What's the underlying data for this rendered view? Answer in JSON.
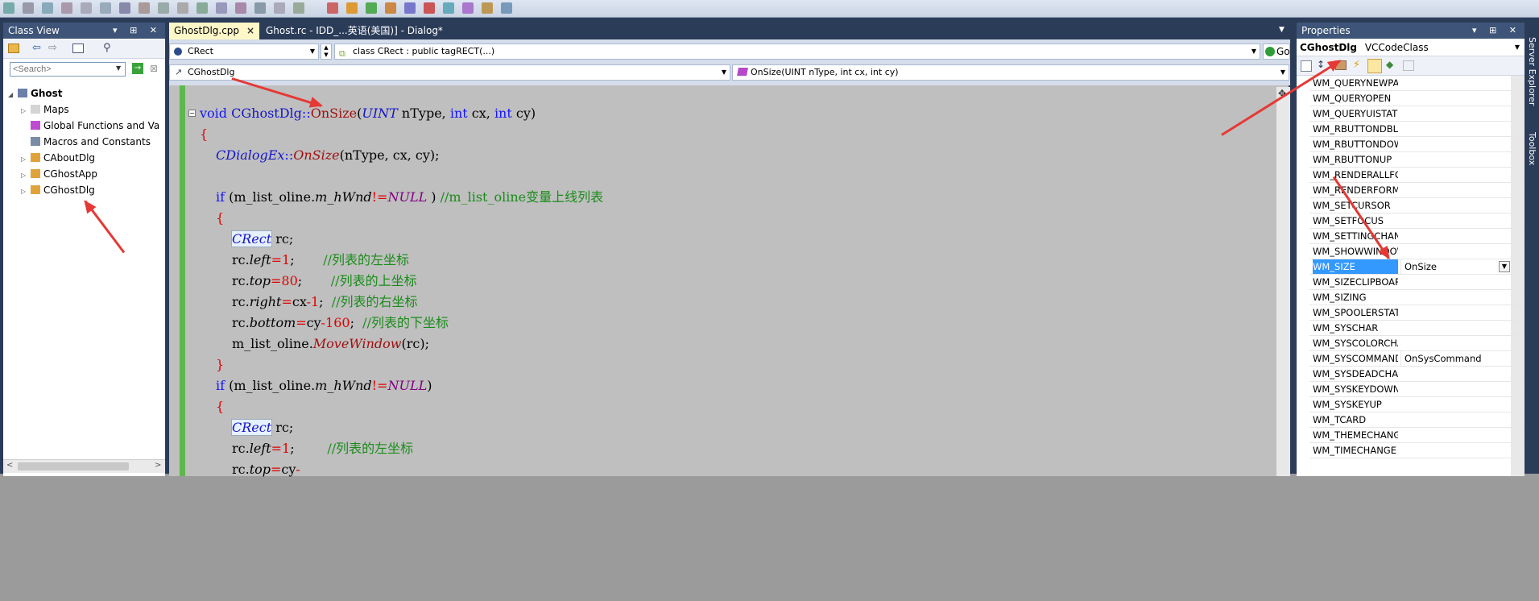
{
  "tabs": [
    {
      "label": "GhostDlg.cpp",
      "close": "×"
    },
    {
      "label": "Ghost.rc - IDD_...英语(美国)] - Dialog*"
    }
  ],
  "class_view": {
    "title": "Class View",
    "controls": "▾ ⊞ ✕",
    "search_placeholder": "<Search>",
    "tree": [
      {
        "label": "Ghost",
        "bold": true,
        "icon": "solution-icon"
      },
      {
        "label": "Maps",
        "icon": "folder-icon"
      },
      {
        "label": "Global Functions and Va",
        "icon": "function-icon"
      },
      {
        "label": "Macros and Constants",
        "icon": "macro-icon"
      },
      {
        "label": "CAboutDlg",
        "icon": "class-icon"
      },
      {
        "label": "CGhostApp",
        "icon": "class-icon"
      },
      {
        "label": "CGhostDlg",
        "icon": "class-icon"
      }
    ]
  },
  "editor": {
    "class_combo": "CRect",
    "def_combo": "class CRect : public tagRECT(...)",
    "go_label": "Go",
    "scope_combo": "CGhostDlg",
    "member_combo": "OnSize(UINT nType, int cx, int cy)"
  },
  "code": [
    {
      "indent": 0,
      "collapse": true,
      "parts": [
        [
          "kw",
          "void "
        ],
        [
          "ty",
          "CGhostDlg"
        ],
        [
          "kw",
          "::"
        ],
        [
          "fn",
          "OnSize"
        ],
        [
          "",
          "("
        ],
        [
          "ty it",
          "UINT"
        ],
        [
          "",
          " nType, "
        ],
        [
          "kw",
          "int"
        ],
        [
          "",
          " cx, "
        ],
        [
          "kw",
          "int"
        ],
        [
          "",
          " cy)"
        ]
      ]
    },
    {
      "indent": 0,
      "parts": [
        [
          "nm",
          "{"
        ]
      ]
    },
    {
      "indent": 1,
      "parts": [
        [
          "ty it",
          "CDialogEx"
        ],
        [
          "kw",
          "::"
        ],
        [
          "fn it",
          "OnSize"
        ],
        [
          "",
          "(nType, cx, cy);"
        ]
      ]
    },
    {
      "indent": 0,
      "parts": []
    },
    {
      "indent": 1,
      "parts": [
        [
          "kw",
          "if"
        ],
        [
          "",
          " (m_list_oline."
        ],
        [
          "it",
          "m_hWnd"
        ],
        [
          "nm",
          "!="
        ],
        [
          "pu it",
          "NULL"
        ],
        [
          "",
          " ) "
        ],
        [
          "cm",
          "//m_list_oline变量上线列表"
        ]
      ]
    },
    {
      "indent": 1,
      "parts": [
        [
          "nm",
          "{"
        ]
      ]
    },
    {
      "indent": 2,
      "parts": [
        [
          "ty it hl",
          "CRect"
        ],
        [
          "",
          " rc;"
        ]
      ]
    },
    {
      "indent": 2,
      "parts": [
        [
          "",
          "rc."
        ],
        [
          "it",
          "left"
        ],
        [
          "nm",
          "="
        ],
        [
          "nm",
          "1"
        ],
        [
          "",
          ";       "
        ],
        [
          "cm",
          "//列表的左坐标"
        ]
      ]
    },
    {
      "indent": 2,
      "parts": [
        [
          "",
          "rc."
        ],
        [
          "it",
          "top"
        ],
        [
          "nm",
          "="
        ],
        [
          "nm",
          "80"
        ],
        [
          "",
          ";       "
        ],
        [
          "cm",
          "//列表的上坐标"
        ]
      ]
    },
    {
      "indent": 2,
      "parts": [
        [
          "",
          "rc."
        ],
        [
          "it",
          "right"
        ],
        [
          "nm",
          "="
        ],
        [
          "",
          "cx"
        ],
        [
          "nm",
          "-1"
        ],
        [
          "",
          ";  "
        ],
        [
          "cm",
          "//列表的右坐标"
        ]
      ]
    },
    {
      "indent": 2,
      "parts": [
        [
          "",
          "rc."
        ],
        [
          "it",
          "bottom"
        ],
        [
          "nm",
          "="
        ],
        [
          "",
          "cy"
        ],
        [
          "nm",
          "-160"
        ],
        [
          "",
          ";  "
        ],
        [
          "cm",
          "//列表的下坐标"
        ]
      ]
    },
    {
      "indent": 2,
      "parts": [
        [
          "",
          "m_list_oline."
        ],
        [
          "fn it",
          "MoveWindow"
        ],
        [
          "",
          "(rc);"
        ]
      ]
    },
    {
      "indent": 1,
      "parts": [
        [
          "nm",
          "}"
        ]
      ]
    },
    {
      "indent": 1,
      "parts": [
        [
          "kw",
          "if"
        ],
        [
          "",
          " (m_list_oline."
        ],
        [
          "it",
          "m_hWnd"
        ],
        [
          "nm",
          "!="
        ],
        [
          "pu it",
          "NULL"
        ],
        [
          "",
          ")"
        ]
      ]
    },
    {
      "indent": 1,
      "parts": [
        [
          "nm",
          "{"
        ]
      ]
    },
    {
      "indent": 2,
      "parts": [
        [
          "ty it hl",
          "CRect"
        ],
        [
          "",
          " rc;"
        ]
      ]
    },
    {
      "indent": 2,
      "parts": [
        [
          "",
          "rc."
        ],
        [
          "it",
          "left"
        ],
        [
          "nm",
          "="
        ],
        [
          "nm",
          "1"
        ],
        [
          "",
          ";        "
        ],
        [
          "cm",
          "//列表的左坐标"
        ]
      ]
    },
    {
      "indent": 2,
      "parts": [
        [
          "",
          "rc."
        ],
        [
          "it",
          "top"
        ],
        [
          "nm",
          "="
        ],
        [
          "",
          "cy"
        ],
        [
          "nm",
          "-"
        ]
      ]
    }
  ],
  "properties": {
    "title": "Properties",
    "controls": "▾ ⊞ ✕",
    "object_name": "CGhostDlg",
    "object_type": "VCCodeClass",
    "rows": [
      {
        "name": "WM_QUERYNEWPALETTE",
        "value": ""
      },
      {
        "name": "WM_QUERYOPEN",
        "value": ""
      },
      {
        "name": "WM_QUERYUISTATE",
        "value": ""
      },
      {
        "name": "WM_RBUTTONDBLCLK",
        "value": ""
      },
      {
        "name": "WM_RBUTTONDOWN",
        "value": ""
      },
      {
        "name": "WM_RBUTTONUP",
        "value": ""
      },
      {
        "name": "WM_RENDERALLFORMATS",
        "value": ""
      },
      {
        "name": "WM_RENDERFORMAT",
        "value": ""
      },
      {
        "name": "WM_SETCURSOR",
        "value": ""
      },
      {
        "name": "WM_SETFOCUS",
        "value": ""
      },
      {
        "name": "WM_SETTINGCHANGE",
        "value": ""
      },
      {
        "name": "WM_SHOWWINDOW",
        "value": ""
      },
      {
        "name": "WM_SIZE",
        "value": "OnSize",
        "selected": true
      },
      {
        "name": "WM_SIZECLIPBOARD",
        "value": ""
      },
      {
        "name": "WM_SIZING",
        "value": ""
      },
      {
        "name": "WM_SPOOLERSTATUS",
        "value": ""
      },
      {
        "name": "WM_SYSCHAR",
        "value": ""
      },
      {
        "name": "WM_SYSCOLORCHANGE",
        "value": ""
      },
      {
        "name": "WM_SYSCOMMAND",
        "value": "OnSysCommand"
      },
      {
        "name": "WM_SYSDEADCHAR",
        "value": ""
      },
      {
        "name": "WM_SYSKEYDOWN",
        "value": ""
      },
      {
        "name": "WM_SYSKEYUP",
        "value": ""
      },
      {
        "name": "WM_TCARD",
        "value": ""
      },
      {
        "name": "WM_THEMECHANGED",
        "value": ""
      },
      {
        "name": "WM_TIMECHANGE",
        "value": ""
      }
    ]
  },
  "side_tabs": {
    "server_explorer": "Server Explorer",
    "toolbox": "Toolbox"
  },
  "colors": {
    "accent": "#3e5478",
    "selection": "#3399ff",
    "arrow": "#e53935",
    "code_bg": "#bfbfbf"
  }
}
